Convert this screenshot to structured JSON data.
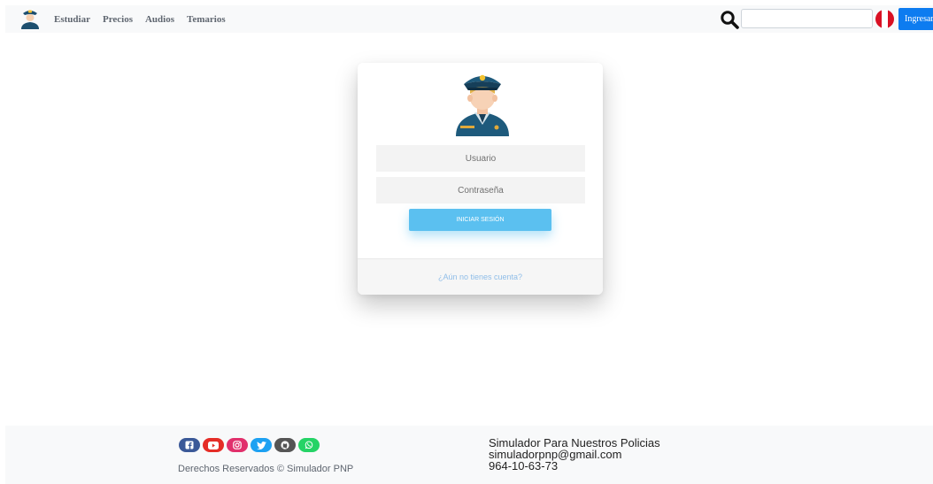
{
  "nav": {
    "links": [
      "Estudiar",
      "Precios",
      "Audios",
      "Temarios"
    ],
    "search_placeholder": "",
    "login_label": "Ingresar",
    "flag_colors": [
      "#d91023",
      "#ffffff"
    ]
  },
  "login": {
    "username_placeholder": "Usuario",
    "password_placeholder": "Contraseña",
    "submit_label": "INICIAR SESIÓN",
    "register_link": "¿Aún no tienes cuenta?"
  },
  "footer": {
    "socials": [
      {
        "icon": "facebook-icon",
        "color": "#3b5998"
      },
      {
        "icon": "youtube-icon",
        "color": "#e52d27"
      },
      {
        "icon": "instagram-icon",
        "color": "#e1306c"
      },
      {
        "icon": "twitter-icon",
        "color": "#1da1f2"
      },
      {
        "icon": "github-icon",
        "color": "#555555"
      },
      {
        "icon": "whatsapp-icon",
        "color": "#25d366"
      }
    ],
    "copyright": "Derechos Reservados © Simulador PNP",
    "site_name": "Simulador Para Nuestros Policias",
    "email": "simuladorpnp@gmail.com",
    "phone": "964-10-63-73"
  },
  "colors": {
    "accent": "#0d7cf0",
    "submit": "#5bc0f0",
    "link": "#8fbde8"
  }
}
